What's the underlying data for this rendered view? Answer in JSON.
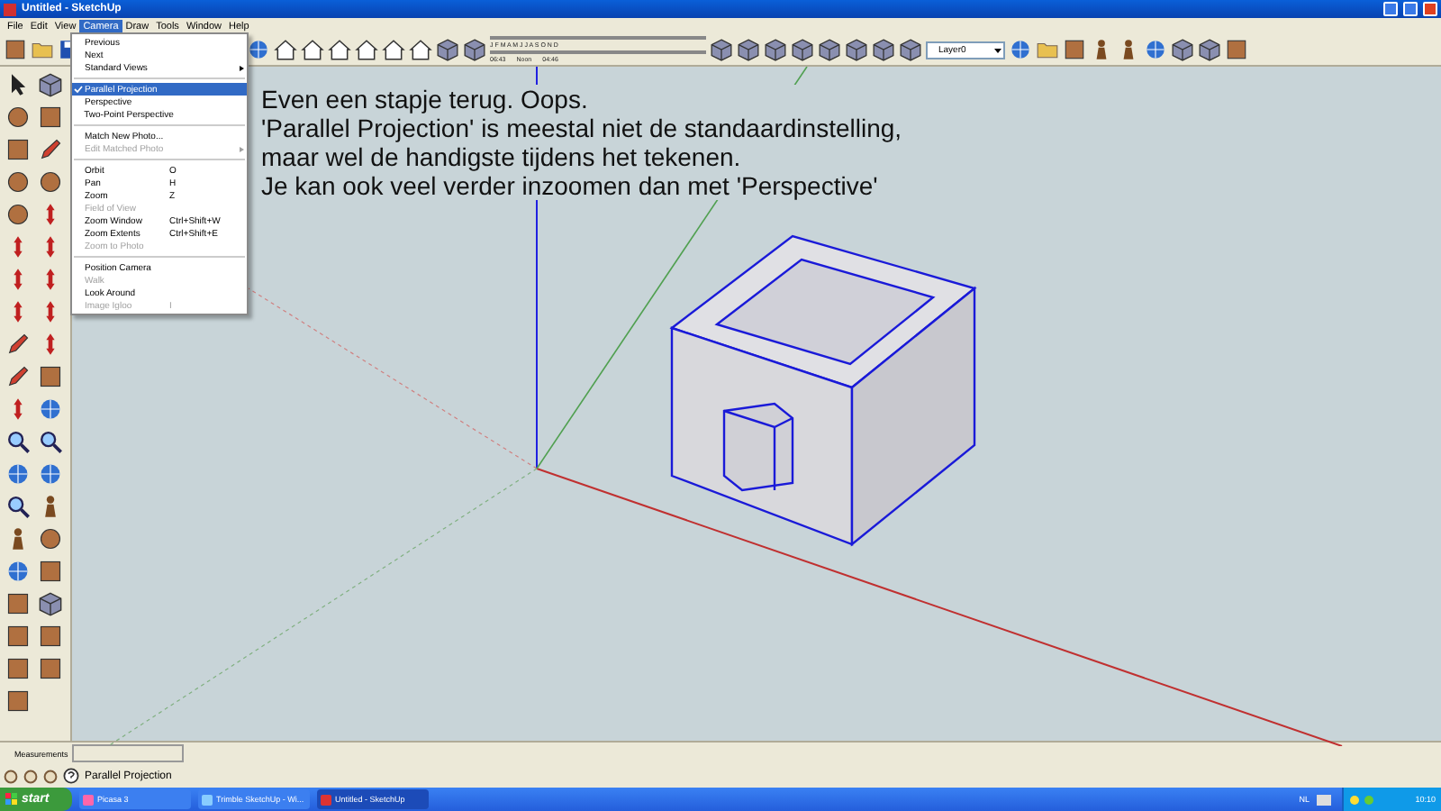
{
  "window": {
    "title": "Untitled - SketchUp"
  },
  "menu_bar": [
    {
      "label": "File",
      "selected": false
    },
    {
      "label": "Edit",
      "selected": false
    },
    {
      "label": "View",
      "selected": false
    },
    {
      "label": "Camera",
      "selected": true
    },
    {
      "label": "Draw",
      "selected": false
    },
    {
      "label": "Tools",
      "selected": false
    },
    {
      "label": "Window",
      "selected": false
    },
    {
      "label": "Help",
      "selected": false
    }
  ],
  "camera_menu": [
    {
      "kind": "item",
      "label": "Previous",
      "selected": false,
      "checked": false,
      "disabled": false,
      "submenu": false
    },
    {
      "kind": "item",
      "label": "Next",
      "selected": false,
      "checked": false,
      "disabled": false,
      "submenu": false
    },
    {
      "kind": "item",
      "label": "Standard Views",
      "selected": false,
      "checked": false,
      "disabled": false,
      "submenu": true
    },
    {
      "kind": "separator"
    },
    {
      "kind": "item",
      "label": "Parallel Projection",
      "selected": true,
      "checked": true,
      "disabled": false,
      "submenu": false
    },
    {
      "kind": "item",
      "label": "Perspective",
      "selected": false,
      "checked": false,
      "disabled": false,
      "submenu": false
    },
    {
      "kind": "item",
      "label": "Two-Point Perspective",
      "selected": false,
      "checked": false,
      "disabled": false,
      "submenu": false
    },
    {
      "kind": "separator"
    },
    {
      "kind": "item",
      "label": "Match New Photo...",
      "selected": false,
      "checked": false,
      "disabled": false,
      "submenu": false
    },
    {
      "kind": "item",
      "label": "Edit Matched Photo",
      "selected": false,
      "checked": false,
      "disabled": true,
      "submenu": true
    },
    {
      "kind": "separator"
    },
    {
      "kind": "item",
      "label": "Orbit",
      "shortcut": "O",
      "selected": false,
      "checked": false,
      "disabled": false,
      "submenu": false
    },
    {
      "kind": "item",
      "label": "Pan",
      "shortcut": "H",
      "selected": false,
      "checked": false,
      "disabled": false,
      "submenu": false
    },
    {
      "kind": "item",
      "label": "Zoom",
      "shortcut": "Z",
      "selected": false,
      "checked": false,
      "disabled": false,
      "submenu": false
    },
    {
      "kind": "item",
      "label": "Field of View",
      "selected": false,
      "checked": false,
      "disabled": true,
      "submenu": false
    },
    {
      "kind": "item",
      "label": "Zoom Window",
      "shortcut": "Ctrl+Shift+W",
      "selected": false,
      "checked": false,
      "disabled": false,
      "submenu": false
    },
    {
      "kind": "item",
      "label": "Zoom Extents",
      "shortcut": "Ctrl+Shift+E",
      "selected": false,
      "checked": false,
      "disabled": false,
      "submenu": false
    },
    {
      "kind": "item",
      "label": "Zoom to Photo",
      "selected": false,
      "checked": false,
      "disabled": true,
      "submenu": false
    },
    {
      "kind": "separator"
    },
    {
      "kind": "item",
      "label": "Position Camera",
      "selected": false,
      "checked": false,
      "disabled": false,
      "submenu": false
    },
    {
      "kind": "item",
      "label": "Walk",
      "selected": false,
      "checked": false,
      "disabled": true,
      "submenu": false
    },
    {
      "kind": "item",
      "label": "Look Around",
      "selected": false,
      "checked": false,
      "disabled": false,
      "submenu": false
    },
    {
      "kind": "item",
      "label": "Image Igloo",
      "shortcut": "I",
      "selected": false,
      "checked": false,
      "disabled": true,
      "submenu": false
    }
  ],
  "toolbar": {
    "shadow_months": "J F M A M J J A S O N D",
    "shadow_time_start": "06:43",
    "shadow_time_mid": "Noon",
    "shadow_time_end": "04:46",
    "layer": "Layer0"
  },
  "annotation": [
    "Even een stapje terug. Oops.",
    "'Parallel Projection' is meestal niet de standaardinstelling,",
    "maar wel de handigste tijdens het tekenen.",
    "Je kan ook veel verder inzoomen dan met 'Perspective'"
  ],
  "measurements": {
    "label": "Measurements"
  },
  "status_bar": {
    "text": "Parallel Projection"
  },
  "taskbar": {
    "start": "start",
    "tasks": [
      {
        "label": "Picasa 3",
        "selected": false
      },
      {
        "label": "Trimble SketchUp - Wi...",
        "selected": false
      },
      {
        "label": "Untitled - SketchUp",
        "selected": true
      }
    ],
    "language": "NL",
    "clock": "10:10"
  }
}
